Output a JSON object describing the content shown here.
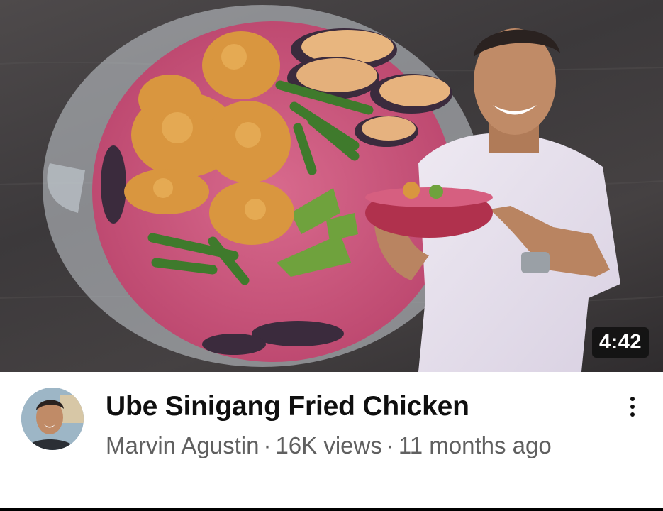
{
  "video": {
    "title": "Ube Sinigang Fried Chicken",
    "duration": "4:42",
    "channel": "Marvin Agustin",
    "views": "16K views",
    "age": "11 months ago",
    "separator": "·"
  },
  "icons": {
    "more": "vertical-ellipsis-icon"
  },
  "colors": {
    "title": "#0f0f0f",
    "secondary_text": "#606060",
    "duration_bg": "#0f0f0f",
    "soup": "#c8557a"
  }
}
